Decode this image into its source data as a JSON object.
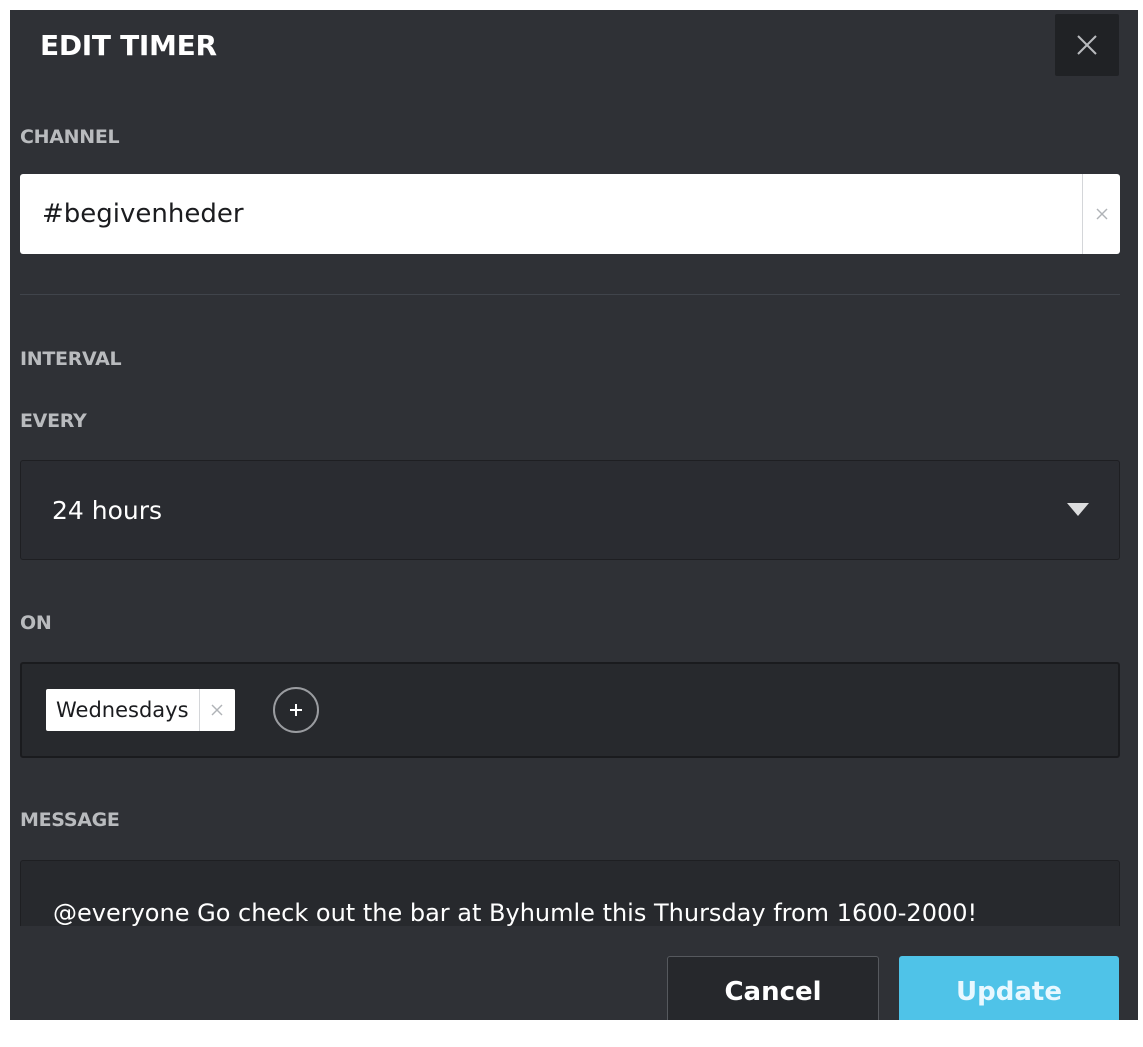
{
  "dialog": {
    "title": "EDIT TIMER"
  },
  "channel": {
    "label": "CHANNEL",
    "value": "#begivenheder"
  },
  "interval": {
    "label": "INTERVAL",
    "every_label": "EVERY",
    "every_value": "24 hours",
    "on_label": "ON",
    "days": [
      "Wednesdays"
    ]
  },
  "message": {
    "label": "MESSAGE",
    "text": "@everyone Go check out the bar at Byhumle this Thursday from 1600-2000!"
  },
  "actions": {
    "cancel_label": "Cancel",
    "update_label": "Update"
  },
  "colors": {
    "background": "#2f3136",
    "accent": "#4fc3e8"
  }
}
